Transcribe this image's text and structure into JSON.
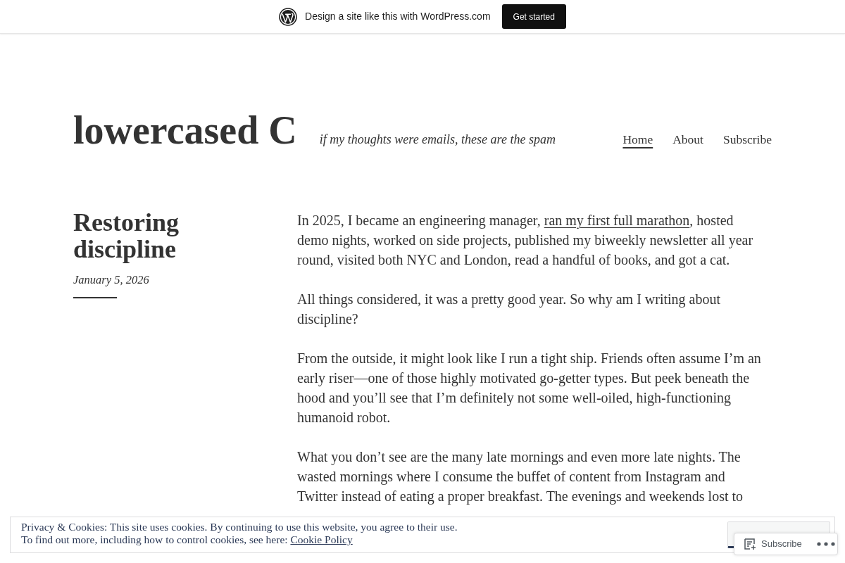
{
  "promo_bar": {
    "text": "Design a site like this with WordPress.com",
    "button": "Get started"
  },
  "header": {
    "site_title": "lowercased C",
    "tagline": "if my thoughts were emails, these are the spam",
    "nav": [
      {
        "label": "Home",
        "selected": true
      },
      {
        "label": "About",
        "selected": false
      },
      {
        "label": "Subscribe",
        "selected": false
      }
    ]
  },
  "post": {
    "title": "Restoring discipline",
    "date": "January 5, 2026",
    "paragraphs": [
      [
        {
          "kind": "text",
          "text": "In 2025, I became an engineering manager, "
        },
        {
          "kind": "link",
          "text": "ran my first full marathon"
        },
        {
          "kind": "text",
          "text": ", hosted demo nights, worked on side projects, published my biweekly newsletter all year round, visited both NYC and London, read a handful of books, and got a cat."
        }
      ],
      [
        {
          "kind": "text",
          "text": "All things considered, it was a pretty good year. So why am I writing about discipline?"
        }
      ],
      [
        {
          "kind": "text",
          "text": "From the outside, it might look like I run a tight ship. Friends often assume I’m an early riser—one of those highly motivated go-getter types. But peek beneath the hood and you’ll see that I’m definitely not some well-oiled, high-functioning humanoid robot."
        }
      ],
      [
        {
          "kind": "text",
          "text": "What you don’t see are the many late mornings and even more late nights. The wasted mornings where I consume the buffet of content from Instagram and Twitter instead of eating a proper breakfast. The evenings and weekends lost to"
        }
      ]
    ]
  },
  "cookie_banner": {
    "notice": "Privacy & Cookies: This site uses cookies. By continuing to use this website, you agree to their use.",
    "more_info": "To find out more, including how to control cookies, see here:",
    "link": "Cookie Policy"
  },
  "subscribe_bar": {
    "label": "Subscribe"
  }
}
